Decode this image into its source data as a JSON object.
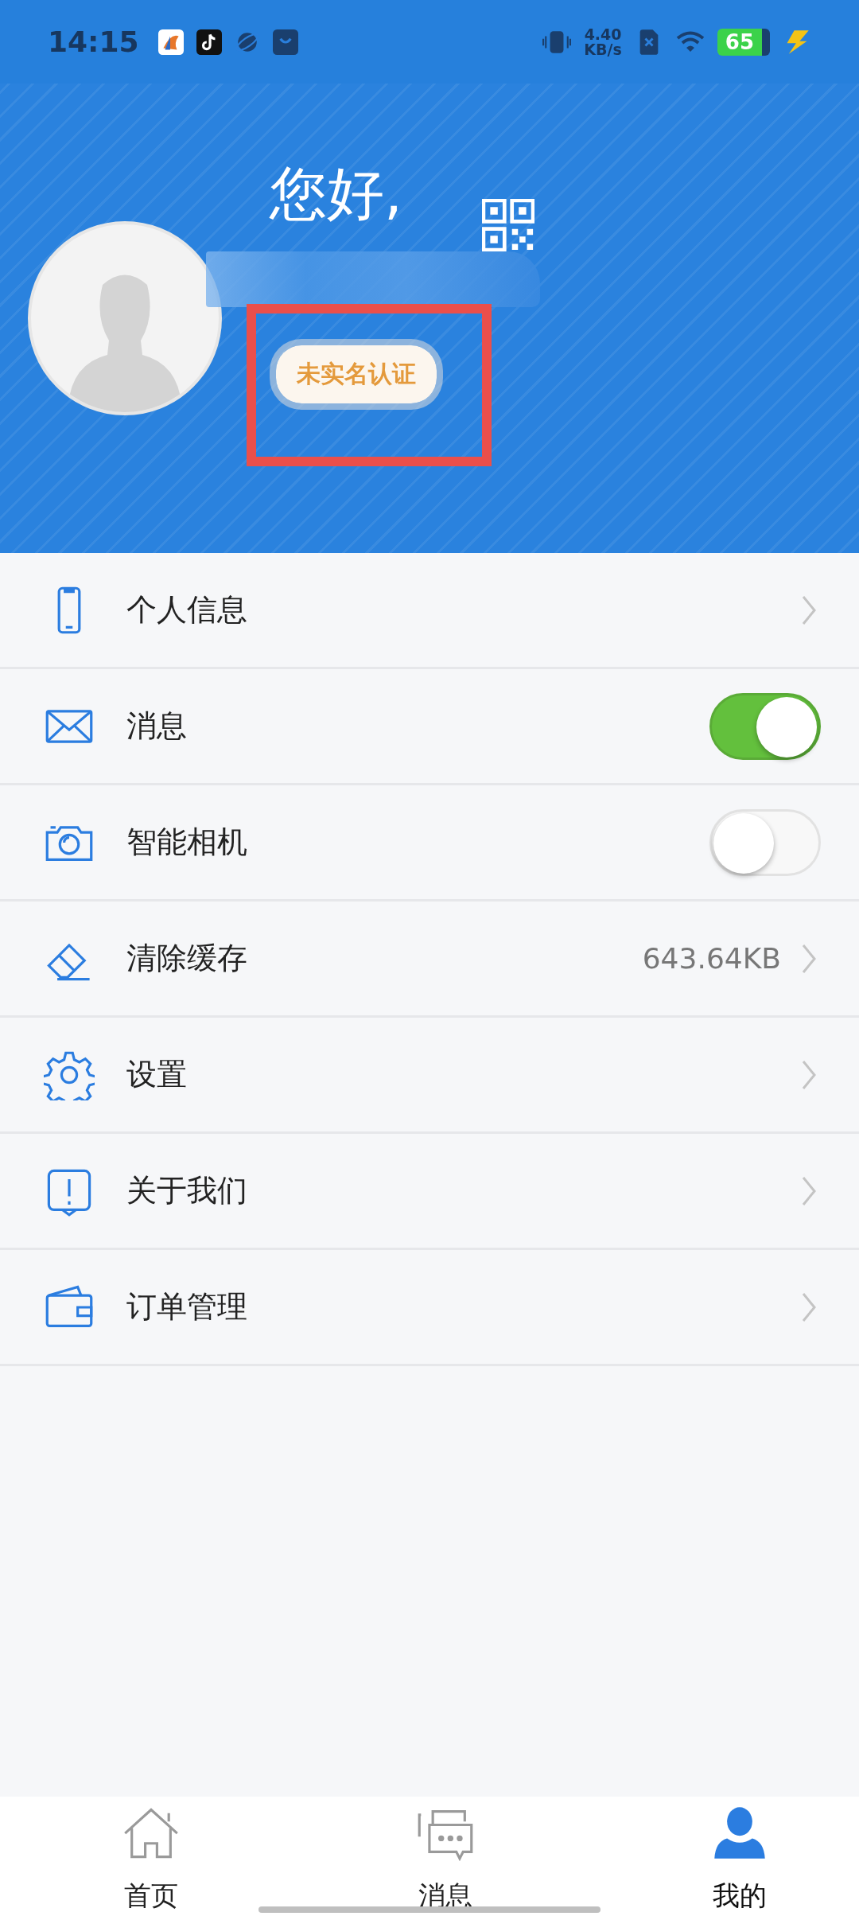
{
  "status_bar": {
    "time": "14:15",
    "net_speed": "4.40",
    "net_unit": "KB/s",
    "battery": "65"
  },
  "profile": {
    "greeting": "您好,",
    "badge": "未实名认证"
  },
  "menu": [
    {
      "kind": "link",
      "label": "个人信息"
    },
    {
      "kind": "toggle",
      "label": "消息",
      "on": true
    },
    {
      "kind": "toggle",
      "label": "智能相机",
      "on": false
    },
    {
      "kind": "value",
      "label": "清除缓存",
      "value": "643.64KB"
    },
    {
      "kind": "link",
      "label": "设置"
    },
    {
      "kind": "link",
      "label": "关于我们"
    },
    {
      "kind": "link",
      "label": "订单管理"
    }
  ],
  "tabs": [
    {
      "label": "首页",
      "selected": false
    },
    {
      "label": "消息",
      "selected": false
    },
    {
      "label": "我的",
      "selected": true
    }
  ]
}
